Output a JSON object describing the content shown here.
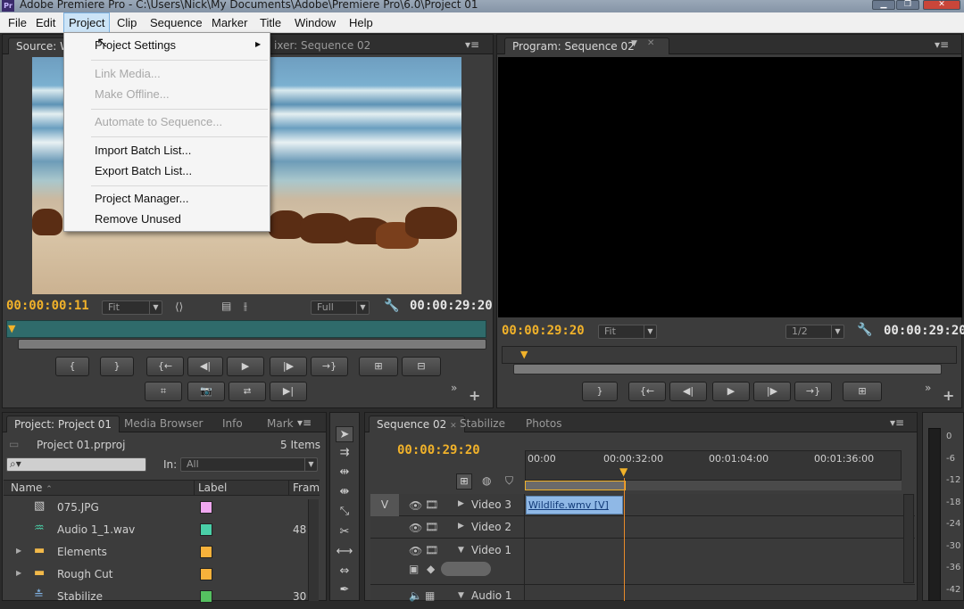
{
  "window": {
    "app_icon": "Pr",
    "title": "Adobe Premiere Pro - C:\\Users\\Nick\\My Documents\\Adobe\\Premiere Pro\\6.0\\Project 01"
  },
  "menubar": {
    "items": [
      "File",
      "Edit",
      "Project",
      "Clip",
      "Sequence",
      "Marker",
      "Title",
      "Window",
      "Help"
    ]
  },
  "project_menu": {
    "items": [
      {
        "label": "Project Settings",
        "enabled": true,
        "submenu": true
      },
      {
        "label": "Link Media...",
        "enabled": false
      },
      {
        "label": "Make Offline...",
        "enabled": false
      },
      {
        "label": "Automate to Sequence...",
        "enabled": false
      },
      {
        "label": "Import Batch List...",
        "enabled": true
      },
      {
        "label": "Export Batch List...",
        "enabled": true
      },
      {
        "label": "Project Manager...",
        "enabled": true
      },
      {
        "label": "Remove Unused",
        "enabled": true
      }
    ]
  },
  "source_panel": {
    "tab_source": "Source: W",
    "tab_mixer": "ixer: Sequence 02",
    "timecode_in": "00:00:00:11",
    "timecode_duration": "00:00:29:20",
    "fit": "Fit",
    "quality": "Full"
  },
  "program_panel": {
    "tab": "Program: Sequence 02",
    "timecode_in": "00:00:29:20",
    "timecode_duration": "00:00:29:20",
    "fit": "Fit",
    "resolution": "1/2"
  },
  "project_panel": {
    "tabs": [
      "Project: Project 01",
      "Media Browser",
      "Info",
      "Mark"
    ],
    "file_name": "Project 01.prproj",
    "item_count": "5 Items",
    "in_label": "In:",
    "in_value": "All",
    "columns": [
      "Name",
      "Label",
      "Fram"
    ],
    "rows": [
      {
        "name": "075.JPG",
        "color": "#f0a8f0",
        "frames": "",
        "icon": "image-icon",
        "folder": false
      },
      {
        "name": "Audio 1_1.wav",
        "color": "#4ad0a8",
        "frames": "48",
        "icon": "audio-icon",
        "folder": false
      },
      {
        "name": "Elements",
        "color": "#f7b23b",
        "frames": "",
        "icon": "folder-icon",
        "folder": true
      },
      {
        "name": "Rough Cut",
        "color": "#f7b23b",
        "frames": "",
        "icon": "folder-icon",
        "folder": true
      },
      {
        "name": "Stabilize",
        "color": "#55c060",
        "frames": "30",
        "icon": "sequence-icon",
        "folder": false
      }
    ]
  },
  "timeline": {
    "tabs": [
      "Sequence 02",
      "Stabilize",
      "Photos"
    ],
    "timecode": "00:00:29:20",
    "ruler": [
      "00:00",
      "00:00:32:00",
      "00:01:04:00",
      "00:01:36:00"
    ],
    "target_label": "V",
    "tracks": [
      {
        "name": "Video 3",
        "clip": "Wildlife.wmv [V]"
      },
      {
        "name": "Video 2",
        "clip": ""
      },
      {
        "name": "Video 1",
        "clip": ""
      },
      {
        "name": "Audio 1",
        "clip": ""
      }
    ]
  },
  "audio_meter": {
    "labels": [
      "0",
      "-6",
      "-12",
      "-18",
      "-24",
      "-30",
      "-36",
      "-42"
    ]
  },
  "colors": {
    "accent_timecode": "#f1b22a",
    "clip_blue": "#8fb8e6",
    "playhead": "#e88a2a"
  }
}
